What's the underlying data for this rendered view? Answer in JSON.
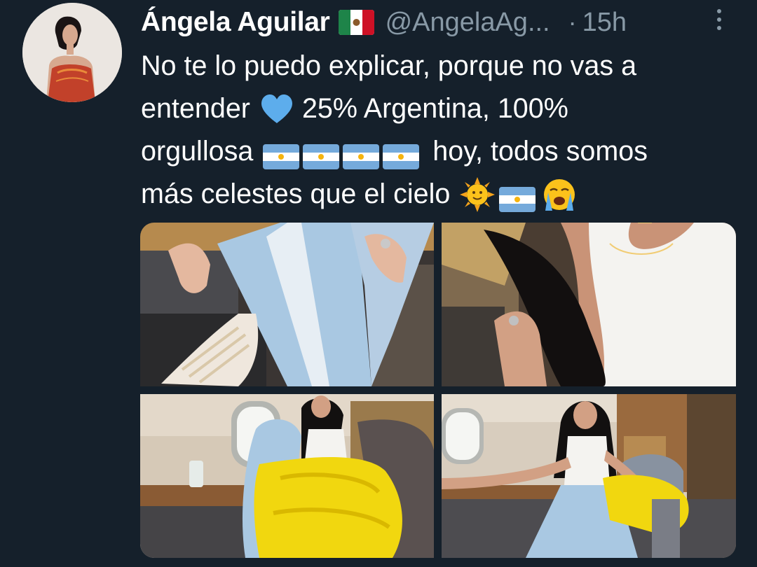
{
  "tweet": {
    "author_name": "Ángela Aguilar",
    "handle": "@AngelaAg...",
    "separator": "·",
    "time": "15h",
    "text_lines": [
      "No te lo puedo explicar, porque no vas a",
      "entender",
      "25% Argentina, 100%",
      "orgullosa",
      "hoy, todos somos",
      "más celestes que el cielo"
    ],
    "icons": {
      "verified_flag": "mexico-flag-icon",
      "more": "more-vertical-icon",
      "heart": "blue-heart-emoji",
      "flag": "argentina-flag-emoji",
      "sun": "sun-with-face-emoji",
      "crying": "loudly-crying-face-emoji"
    },
    "colors": {
      "background": "#15202b",
      "secondary_text": "#8899a6",
      "primary_text": "#ffffff",
      "heart": "#5dadec"
    },
    "media_count": 4
  }
}
